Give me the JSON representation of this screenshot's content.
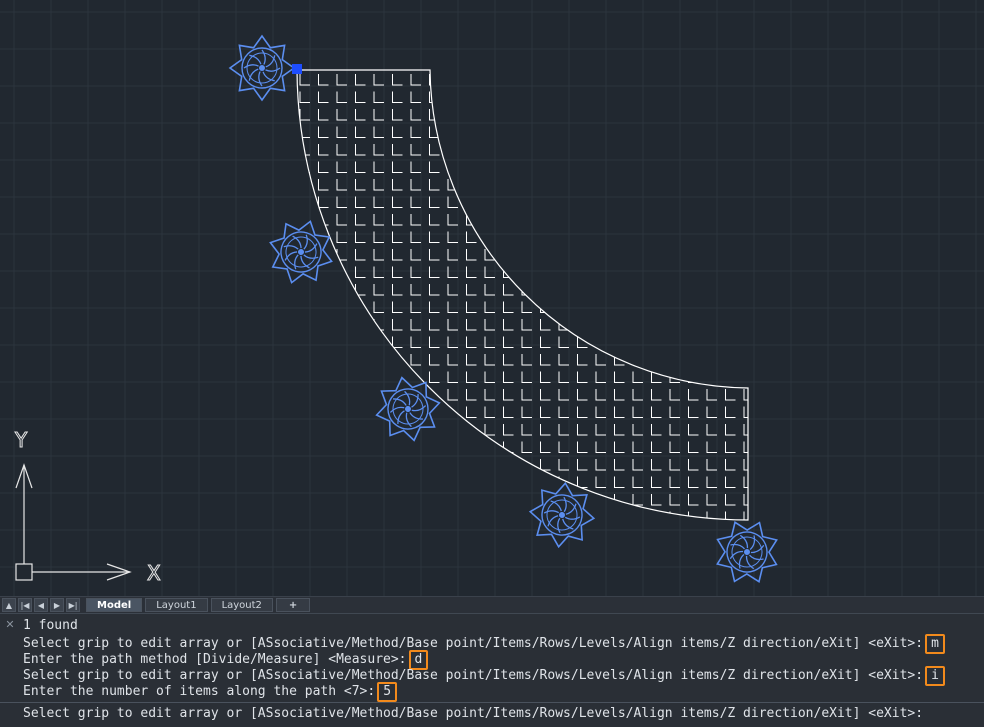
{
  "canvas": {
    "ucs": {
      "x_label": "X",
      "y_label": "Y"
    }
  },
  "layout_tabs": {
    "nav_buttons": [
      "▲",
      "|◀",
      "◀",
      "▶",
      "▶|"
    ],
    "tabs": [
      {
        "label": "Model",
        "active": true
      },
      {
        "label": "Layout1",
        "active": false
      },
      {
        "label": "Layout2",
        "active": false
      },
      {
        "label": "+",
        "active": false
      }
    ]
  },
  "command_line": {
    "close_glyph": "✕",
    "history": [
      {
        "text": "1 found",
        "response": ""
      },
      {
        "text": "Select grip to edit array or [ASsociative/Method/Base point/Items/Rows/Levels/Align items/Z direction/eXit] <eXit>:",
        "response": "m"
      },
      {
        "text": "Enter the path method [Divide/Measure] <Measure>:",
        "response": "d"
      },
      {
        "text": "Select grip to edit array or [ASsociative/Method/Base point/Items/Rows/Levels/Align items/Z direction/eXit] <eXit>:",
        "response": "i"
      },
      {
        "text": "Enter the number of items along the path <7>:",
        "response": "5"
      }
    ],
    "prompt": "Select grip to edit array or [ASsociative/Method/Base point/Items/Rows/Levels/Align items/Z direction/eXit] <eXit>:",
    "input_value": ""
  },
  "colors": {
    "background": "#212830",
    "grid": "#2c343d",
    "hatch": "#ffffff",
    "symbol": "#5b8ef0",
    "grip": "#1d4dff",
    "highlight": "#f28a1c"
  }
}
